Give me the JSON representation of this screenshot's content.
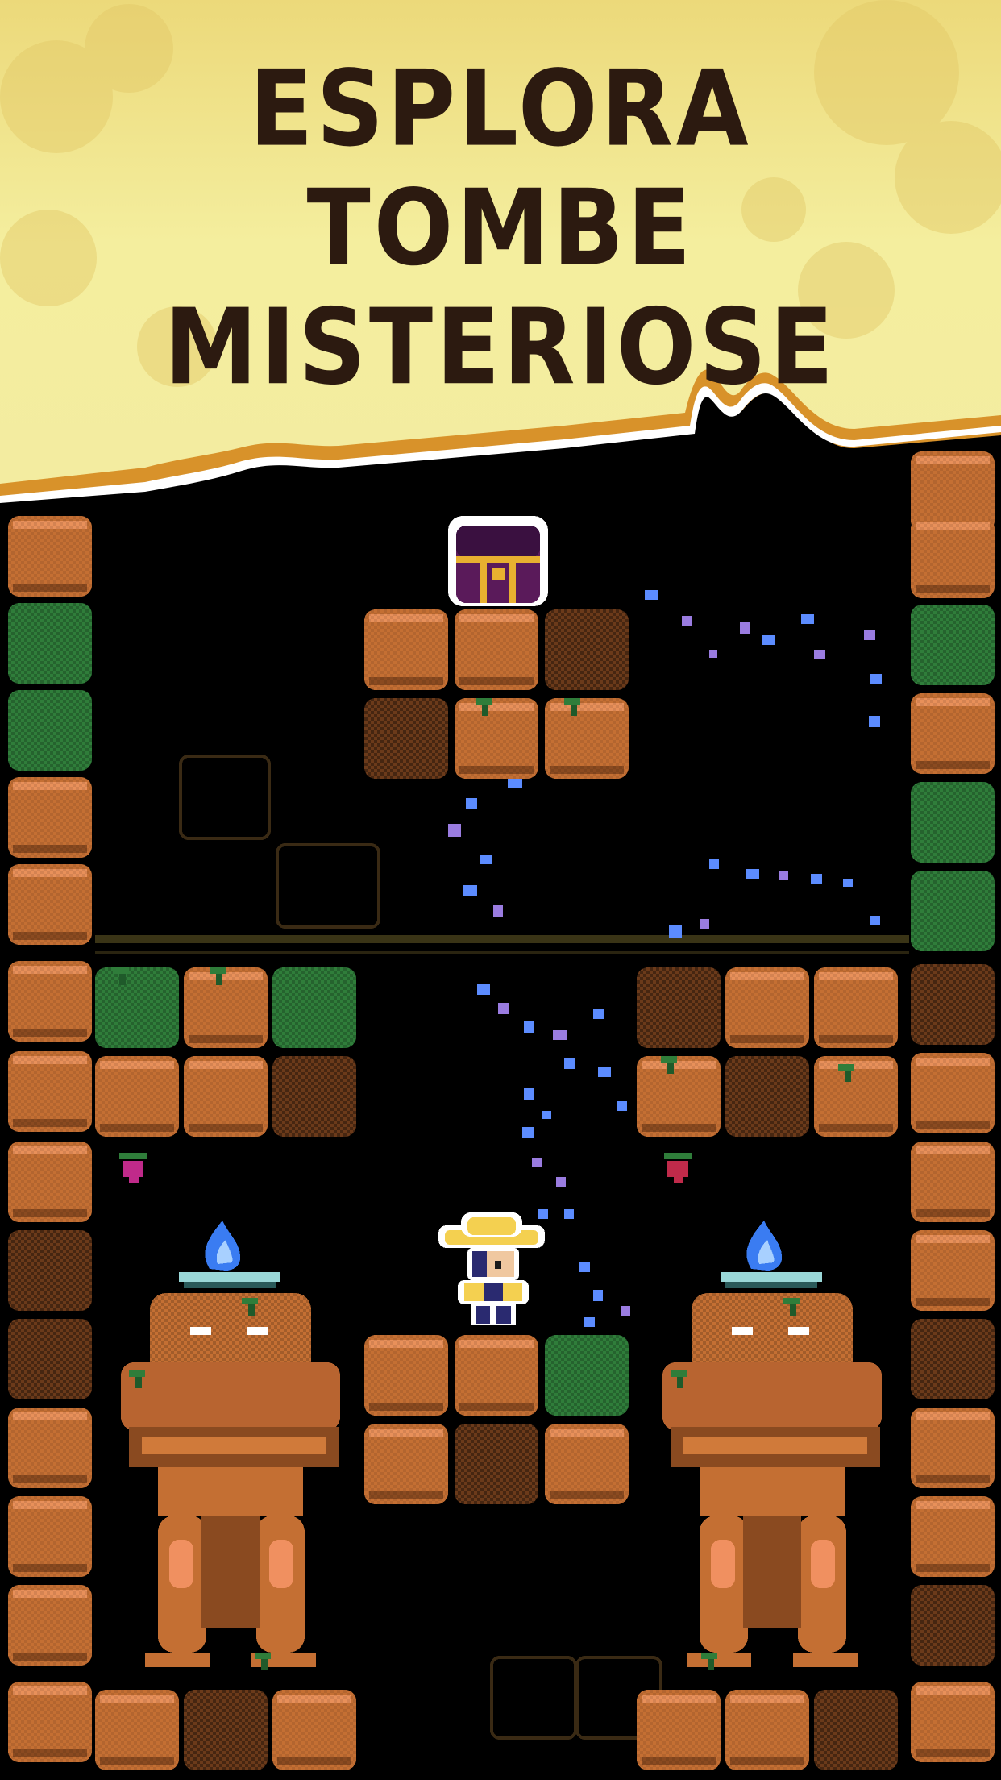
{
  "screen": {
    "title_lines": [
      "ESPLORA",
      "TOMBE",
      "MISTERIOSE"
    ],
    "colors": {
      "banner_light": "#f3eea0",
      "banner_dark": "#e8cc62",
      "banner_trim": "#d8922a",
      "title_text": "#2c1a10",
      "dirt": "#c46f33",
      "dirt_light": "#e8905a",
      "dirt_dark": "#6b3a1a",
      "moss": "#2f7d3a",
      "moss_dark": "#1f5a2a",
      "flame": "#3a7cf2",
      "sparkle_blue": "#5c8cff",
      "sparkle_purple": "#9a7ce0"
    }
  },
  "scene": {
    "chest": "treasure-chest",
    "hero": "explorer-character",
    "left_statue": "stone-guardian-statue",
    "right_statue": "stone-guardian-statue",
    "torches": [
      "blue-flame-brazier",
      "blue-flame-brazier"
    ]
  }
}
